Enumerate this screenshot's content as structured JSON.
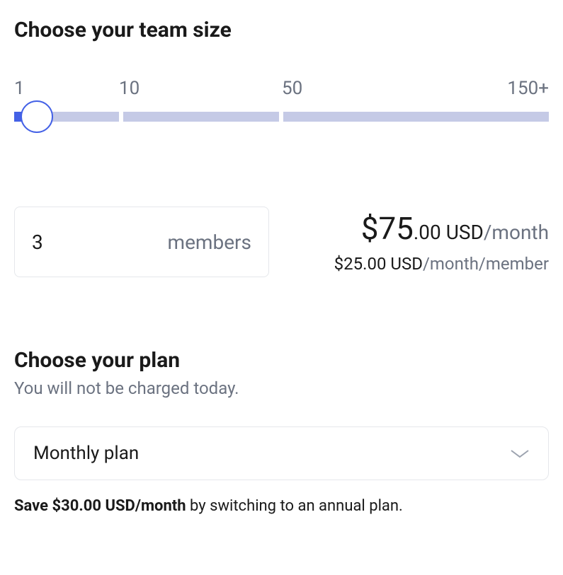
{
  "team_size": {
    "title": "Choose your team size",
    "labels": [
      "1",
      "10",
      "50",
      "150+"
    ]
  },
  "members": {
    "value": "3",
    "suffix": "members"
  },
  "pricing": {
    "currency": "$",
    "total_major": "75",
    "total_minor": ".00",
    "total_currency_label": " USD",
    "total_period": "/month",
    "per_member_amount": "$25.00 USD",
    "per_member_period": "/month/member"
  },
  "plan": {
    "title": "Choose your plan",
    "subtitle": "You will not be charged today.",
    "selected": "Monthly plan"
  },
  "savings": {
    "prefix": "Save ",
    "amount": "$30.00 USD/month",
    "suffix": " by switching to an annual plan."
  }
}
